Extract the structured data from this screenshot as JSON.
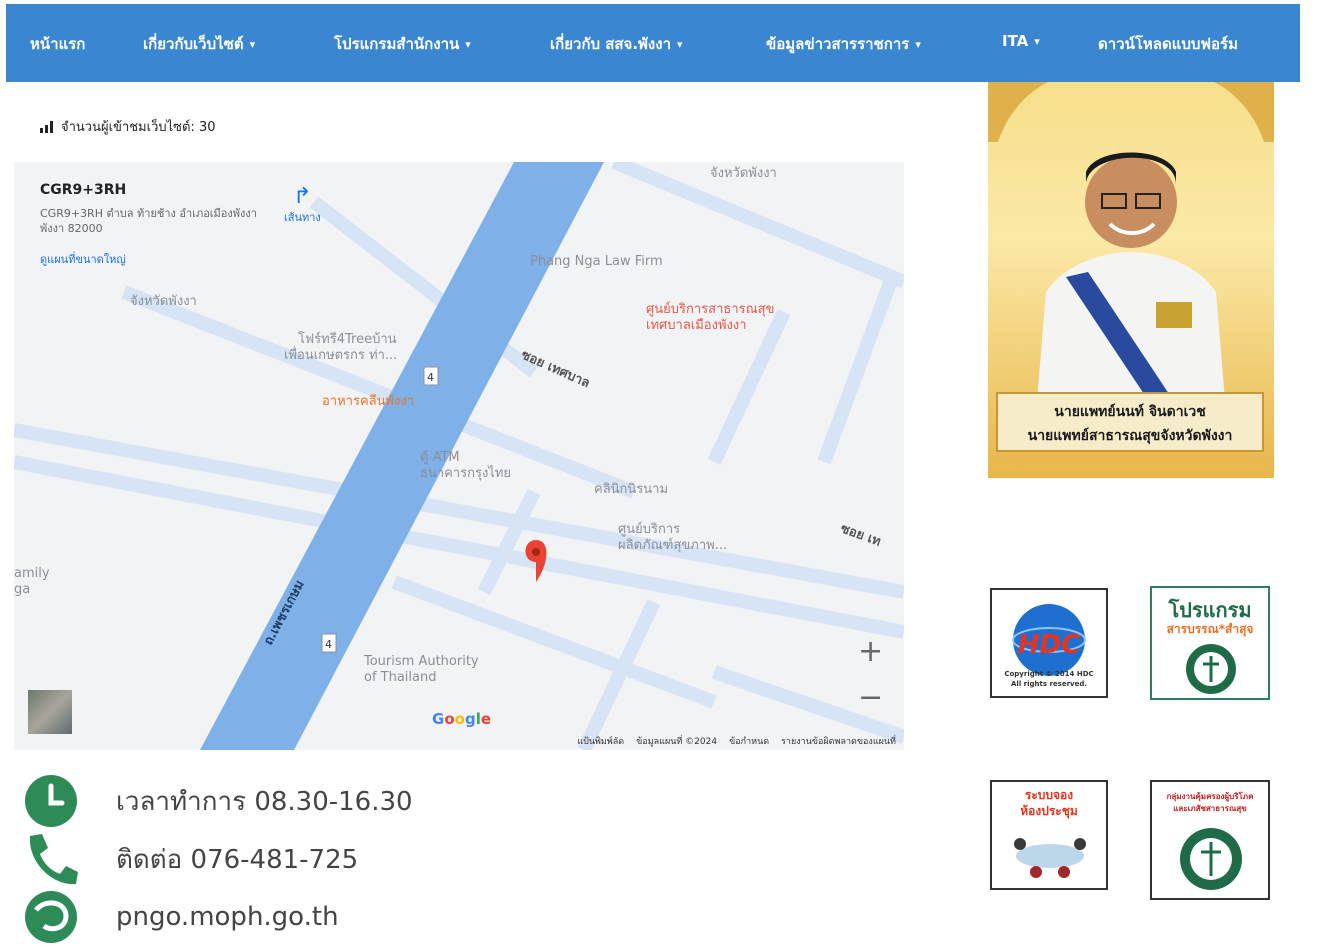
{
  "nav": {
    "items": [
      {
        "label": "หน้าแรก",
        "dropdown": false
      },
      {
        "label": "เกี่ยวกับเว็บไซต์",
        "dropdown": true
      },
      {
        "label": "โปรแกรมสำนักงาน",
        "dropdown": true
      },
      {
        "label": "เกี่ยวกับ สสจ.พังงา",
        "dropdown": true
      },
      {
        "label": "ข้อมูลข่าวสารราชการ",
        "dropdown": true
      },
      {
        "label": "ITA",
        "dropdown": true
      },
      {
        "label": "ดาวน์โหลดแบบฟอร์ม",
        "dropdown": false
      }
    ],
    "chevron": "⌄"
  },
  "visitors": {
    "label": "จำนวนผู้เข้าชมเว็บไซต์: 30"
  },
  "map": {
    "place_code": "CGR9+3RH",
    "address": "CGR9+3RH ตำบล ท้ายช้าง อำเภอเมืองพังงา พังงา 82000",
    "view_larger": "ดูแผนที่ขนาดใหญ่",
    "directions": "เส้นทาง",
    "pois": {
      "province_top": "จังหวัดพังงา",
      "province_left": "จังหวัดพังงา",
      "law_firm": "Phang Nga Law Firm",
      "health_center_1": "ศูนย์บริการสาธารณสุข",
      "health_center_2": "เทศบาลเมืองพังงา",
      "tree_1": "โฟร์ทรี4Treeบ้าน",
      "tree_2": "เพื่อนเกษตรกร ท่า...",
      "restaurant": "อาหารคลีนพังงา",
      "atm_1": "ตู้ ATM",
      "atm_2": "ธนาคารกรุงไทย",
      "clinic": "คลินิกนิรนาม",
      "service_1": "ศูนย์บริการ",
      "service_2": "ผลิตภัณฑ์สุขภาพ...",
      "tat_1": "Tourism Authority",
      "tat_2": "of Thailand",
      "family_1": "amily",
      "family_2": "ga",
      "soi_1": "ซอย เทศบาล",
      "soi_2": "ซอย เท",
      "road": "ถ.เพชรเกษม",
      "route_shield": "4"
    },
    "zoom_in": "+",
    "zoom_out": "−",
    "google": "Google",
    "footer": {
      "shortcuts": "แป้นพิมพ์ลัด",
      "map_data": "ข้อมูลแผนที่ ©2024",
      "terms": "ข้อกำหนด",
      "report": "รายงานข้อผิดพลาดของแผนที่"
    }
  },
  "contact": {
    "hours": "เวลาทำการ 08.30-16.30",
    "phone": "ติดต่อ 076-481-725",
    "website": "pngo.moph.go.th"
  },
  "director": {
    "name": "นายแพทย์นนท์ จินดาเวช",
    "position": "นายแพทย์สาธารณสุขจังหวัดพังงา"
  },
  "badges": {
    "hdc": {
      "title": "HDC",
      "copyright_1": "Copyright © 2014 HDC",
      "copyright_2": "All rights reserved."
    },
    "program": {
      "title_1": "โปรแกรม",
      "title_2": "สารบรรณ*สำสุจ"
    },
    "meeting": {
      "title_1": "ระบบจอง",
      "title_2": "ห้องประชุม"
    },
    "consumer": {
      "title_1": "กลุ่มงานคุ้มครองผู้บริโภค",
      "title_2": "และเภสัชสาธารณสุข"
    }
  },
  "colors": {
    "nav": "#3b86d0",
    "road": "#7fb0e8",
    "contact_icon": "#2e8b57",
    "pin": "#ea4335"
  }
}
